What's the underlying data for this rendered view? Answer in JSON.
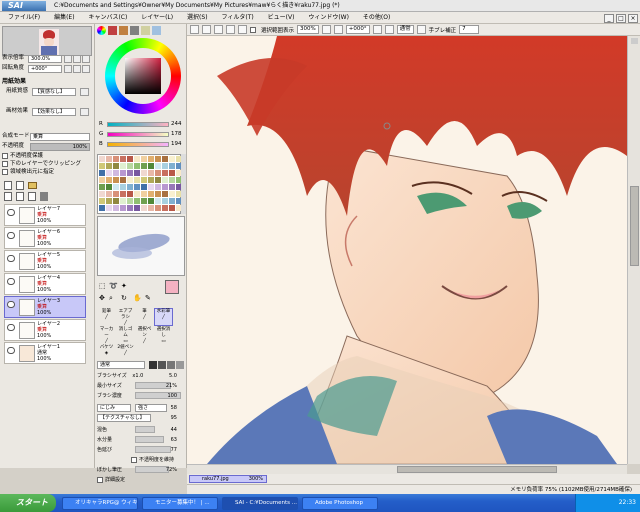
{
  "app": {
    "logo": "SAI",
    "window_title": "C:¥Documents and Settings¥Owner¥My Documents¥My Pictures¥maw¥らく描き¥raku77.jpg (*)"
  },
  "menu": [
    "ファイル(F)",
    "編集(E)",
    "キャンバス(C)",
    "レイヤー(L)",
    "選択(S)",
    "フィルタ(T)",
    "ビュー(V)",
    "ウィンドウ(W)",
    "その他(O)"
  ],
  "toolbar": {
    "selection_label": "選択範囲表示",
    "zoom": "300%",
    "rotation": "+000°",
    "mode": "通常",
    "stabilizer_label": "手ブレ補正",
    "stabilizer_value": "7"
  },
  "navigator": {
    "zoom_label": "表示倍率",
    "zoom_value": "300.0%",
    "rotation_label": "回転角度",
    "rotation_value": "+000°"
  },
  "paper_effect": {
    "header": "用紙効果",
    "texture_label": "用紙質感",
    "texture_value": "【質感なし】",
    "effect_label": "画材効果",
    "effect_value": "【効果なし】"
  },
  "layer_panel": {
    "blend_label": "合成モード",
    "blend_value": "乗算",
    "opacity_label": "不透明度",
    "opacity_value": "100%",
    "options": [
      "不透明度保護",
      "下のレイヤーでクリッピング",
      "領域検出元に指定"
    ],
    "layers": [
      {
        "name": "レイヤー7",
        "mode": "乗算",
        "opacity": "100%",
        "selected": false
      },
      {
        "name": "レイヤー6",
        "mode": "乗算",
        "opacity": "100%",
        "selected": false
      },
      {
        "name": "レイヤー5",
        "mode": "乗算",
        "opacity": "100%",
        "selected": false
      },
      {
        "name": "レイヤー4",
        "mode": "乗算",
        "opacity": "100%",
        "selected": false
      },
      {
        "name": "レイヤー3",
        "mode": "乗算",
        "opacity": "100%",
        "selected": true
      },
      {
        "name": "レイヤー2",
        "mode": "乗算",
        "opacity": "100%",
        "selected": false
      },
      {
        "name": "レイヤー1",
        "mode": "通常",
        "opacity": "100%",
        "selected": false
      }
    ]
  },
  "color": {
    "r_label": "R",
    "r_value": "244",
    "g_label": "G",
    "g_value": "178",
    "b_label": "B",
    "b_value": "194",
    "main": "#f4b2c2",
    "ring": "#d08090"
  },
  "tools": [
    "鉛筆",
    "エアブラシ",
    "筆",
    "水彩筆",
    "マーカー",
    "消しゴム",
    "選択ペン",
    "選択消し",
    "バケツ",
    "2値ペン"
  ],
  "brush": {
    "mode": "通常",
    "size_label": "ブラシサイズ",
    "size_mult": "x1.0",
    "size_value": "5.0",
    "min_size_label": "最小サイズ",
    "min_size_value": "21%",
    "density_label": "ブラシ濃度",
    "density_value": "100",
    "shape_label": "にじみ",
    "shape_value": "強さ",
    "shape_num": "58",
    "texture_label": "【テクスチャなし】",
    "texture_num": "95",
    "mix_label": "混色",
    "mix_value": "44",
    "water_label": "水分量",
    "water_value": "63",
    "persist_label": "色延び",
    "persist_value": "77",
    "keep_opacity_label": "不透明度を維持",
    "blur_label": "ぼかし筆圧",
    "blur_value": "72%",
    "detail_label": "詳細設定"
  },
  "canvas_tab": {
    "name": "raku77.jpg",
    "zoom": "300%"
  },
  "status": {
    "memory": "メモリ負荷率 75% (1102MB使用/2714MB確保)"
  },
  "taskbar": {
    "start": "スタート",
    "tasks": [
      "オリキャラRPG@ ウィキ ...",
      "モニター募集中！ | ...",
      "SAI - C:¥Documents ...",
      "Adobe Photoshop"
    ],
    "clock": "22:33"
  }
}
